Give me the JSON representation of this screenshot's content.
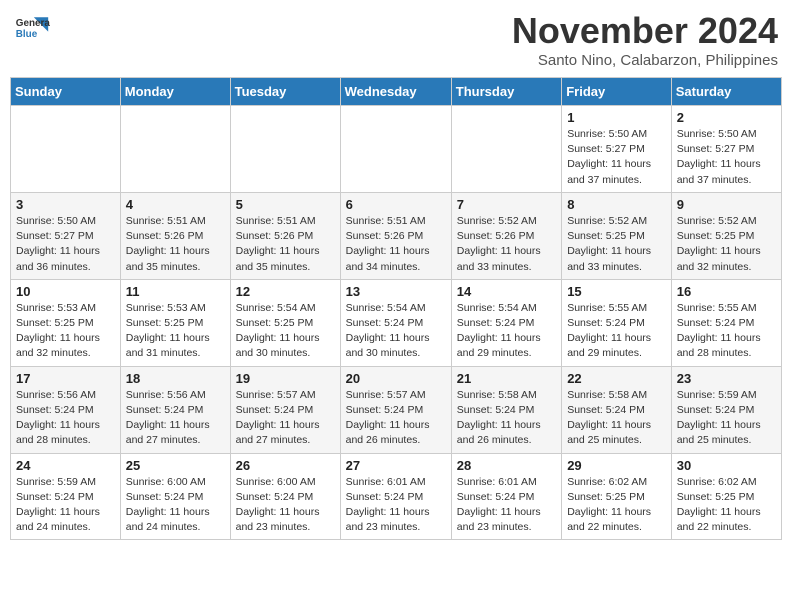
{
  "logo": {
    "line1": "General",
    "line2": "Blue"
  },
  "title": "November 2024",
  "location": "Santo Nino, Calabarzon, Philippines",
  "headers": [
    "Sunday",
    "Monday",
    "Tuesday",
    "Wednesday",
    "Thursday",
    "Friday",
    "Saturday"
  ],
  "weeks": [
    [
      {
        "day": "",
        "info": ""
      },
      {
        "day": "",
        "info": ""
      },
      {
        "day": "",
        "info": ""
      },
      {
        "day": "",
        "info": ""
      },
      {
        "day": "",
        "info": ""
      },
      {
        "day": "1",
        "info": "Sunrise: 5:50 AM\nSunset: 5:27 PM\nDaylight: 11 hours\nand 37 minutes."
      },
      {
        "day": "2",
        "info": "Sunrise: 5:50 AM\nSunset: 5:27 PM\nDaylight: 11 hours\nand 37 minutes."
      }
    ],
    [
      {
        "day": "3",
        "info": "Sunrise: 5:50 AM\nSunset: 5:27 PM\nDaylight: 11 hours\nand 36 minutes."
      },
      {
        "day": "4",
        "info": "Sunrise: 5:51 AM\nSunset: 5:26 PM\nDaylight: 11 hours\nand 35 minutes."
      },
      {
        "day": "5",
        "info": "Sunrise: 5:51 AM\nSunset: 5:26 PM\nDaylight: 11 hours\nand 35 minutes."
      },
      {
        "day": "6",
        "info": "Sunrise: 5:51 AM\nSunset: 5:26 PM\nDaylight: 11 hours\nand 34 minutes."
      },
      {
        "day": "7",
        "info": "Sunrise: 5:52 AM\nSunset: 5:26 PM\nDaylight: 11 hours\nand 33 minutes."
      },
      {
        "day": "8",
        "info": "Sunrise: 5:52 AM\nSunset: 5:25 PM\nDaylight: 11 hours\nand 33 minutes."
      },
      {
        "day": "9",
        "info": "Sunrise: 5:52 AM\nSunset: 5:25 PM\nDaylight: 11 hours\nand 32 minutes."
      }
    ],
    [
      {
        "day": "10",
        "info": "Sunrise: 5:53 AM\nSunset: 5:25 PM\nDaylight: 11 hours\nand 32 minutes."
      },
      {
        "day": "11",
        "info": "Sunrise: 5:53 AM\nSunset: 5:25 PM\nDaylight: 11 hours\nand 31 minutes."
      },
      {
        "day": "12",
        "info": "Sunrise: 5:54 AM\nSunset: 5:25 PM\nDaylight: 11 hours\nand 30 minutes."
      },
      {
        "day": "13",
        "info": "Sunrise: 5:54 AM\nSunset: 5:24 PM\nDaylight: 11 hours\nand 30 minutes."
      },
      {
        "day": "14",
        "info": "Sunrise: 5:54 AM\nSunset: 5:24 PM\nDaylight: 11 hours\nand 29 minutes."
      },
      {
        "day": "15",
        "info": "Sunrise: 5:55 AM\nSunset: 5:24 PM\nDaylight: 11 hours\nand 29 minutes."
      },
      {
        "day": "16",
        "info": "Sunrise: 5:55 AM\nSunset: 5:24 PM\nDaylight: 11 hours\nand 28 minutes."
      }
    ],
    [
      {
        "day": "17",
        "info": "Sunrise: 5:56 AM\nSunset: 5:24 PM\nDaylight: 11 hours\nand 28 minutes."
      },
      {
        "day": "18",
        "info": "Sunrise: 5:56 AM\nSunset: 5:24 PM\nDaylight: 11 hours\nand 27 minutes."
      },
      {
        "day": "19",
        "info": "Sunrise: 5:57 AM\nSunset: 5:24 PM\nDaylight: 11 hours\nand 27 minutes."
      },
      {
        "day": "20",
        "info": "Sunrise: 5:57 AM\nSunset: 5:24 PM\nDaylight: 11 hours\nand 26 minutes."
      },
      {
        "day": "21",
        "info": "Sunrise: 5:58 AM\nSunset: 5:24 PM\nDaylight: 11 hours\nand 26 minutes."
      },
      {
        "day": "22",
        "info": "Sunrise: 5:58 AM\nSunset: 5:24 PM\nDaylight: 11 hours\nand 25 minutes."
      },
      {
        "day": "23",
        "info": "Sunrise: 5:59 AM\nSunset: 5:24 PM\nDaylight: 11 hours\nand 25 minutes."
      }
    ],
    [
      {
        "day": "24",
        "info": "Sunrise: 5:59 AM\nSunset: 5:24 PM\nDaylight: 11 hours\nand 24 minutes."
      },
      {
        "day": "25",
        "info": "Sunrise: 6:00 AM\nSunset: 5:24 PM\nDaylight: 11 hours\nand 24 minutes."
      },
      {
        "day": "26",
        "info": "Sunrise: 6:00 AM\nSunset: 5:24 PM\nDaylight: 11 hours\nand 23 minutes."
      },
      {
        "day": "27",
        "info": "Sunrise: 6:01 AM\nSunset: 5:24 PM\nDaylight: 11 hours\nand 23 minutes."
      },
      {
        "day": "28",
        "info": "Sunrise: 6:01 AM\nSunset: 5:24 PM\nDaylight: 11 hours\nand 23 minutes."
      },
      {
        "day": "29",
        "info": "Sunrise: 6:02 AM\nSunset: 5:25 PM\nDaylight: 11 hours\nand 22 minutes."
      },
      {
        "day": "30",
        "info": "Sunrise: 6:02 AM\nSunset: 5:25 PM\nDaylight: 11 hours\nand 22 minutes."
      }
    ]
  ]
}
